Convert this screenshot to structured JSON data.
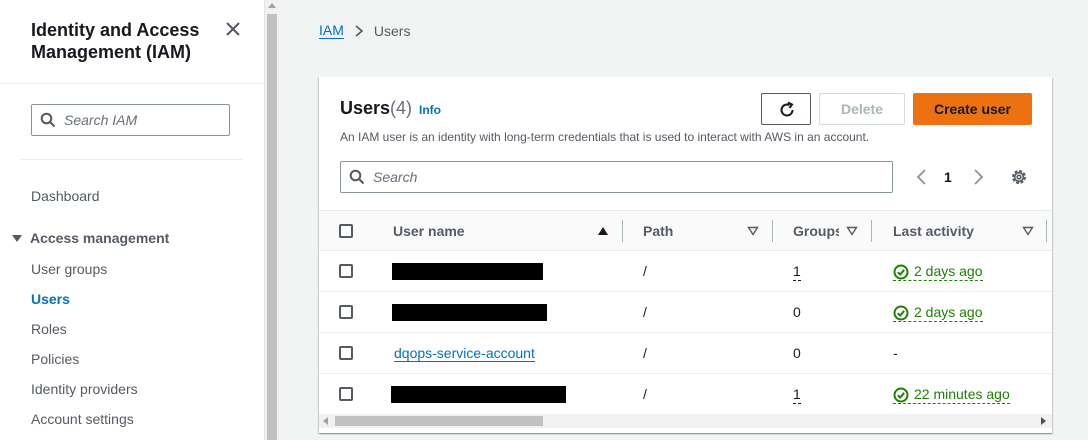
{
  "sidebar": {
    "title": "Identity and Access Management (IAM)",
    "search_placeholder": "Search IAM",
    "dashboard": "Dashboard",
    "section": "Access management",
    "items": [
      {
        "label": "User groups"
      },
      {
        "label": "Users"
      },
      {
        "label": "Roles"
      },
      {
        "label": "Policies"
      },
      {
        "label": "Identity providers"
      },
      {
        "label": "Account settings"
      }
    ]
  },
  "breadcrumb": {
    "root": "IAM",
    "current": "Users"
  },
  "header": {
    "title": "Users",
    "count": "(4)",
    "info": "Info",
    "description": "An IAM user is an identity with long-term credentials that is used to interact with AWS in an account.",
    "delete_label": "Delete",
    "create_label": "Create user"
  },
  "search": {
    "placeholder": "Search"
  },
  "pagination": {
    "page": "1"
  },
  "table": {
    "columns": [
      "User name",
      "Path",
      "Groups",
      "Last activity"
    ],
    "rows": [
      {
        "user_name": "",
        "redacted": true,
        "path": "/",
        "groups": "1",
        "groups_link": true,
        "last_activity": "2 days ago",
        "activity_link": true
      },
      {
        "user_name": "",
        "redacted": true,
        "path": "/",
        "groups": "0",
        "groups_link": false,
        "last_activity": "2 days ago",
        "activity_link": true
      },
      {
        "user_name": "dqops-service-account",
        "redacted": false,
        "path": "/",
        "groups": "0",
        "groups_link": false,
        "last_activity": "-",
        "activity_link": false
      },
      {
        "user_name": "",
        "redacted": true,
        "path": "/",
        "groups": "1",
        "groups_link": true,
        "last_activity": "22 minutes ago",
        "activity_link": true
      }
    ]
  },
  "colors": {
    "link": "#0073bb",
    "primary": "#ec7211",
    "success": "#1d8102"
  },
  "icons": {
    "close": "close-icon",
    "search": "search-icon",
    "refresh": "refresh-icon",
    "settings": "gear-icon",
    "status_ok": "check-circle-icon"
  }
}
